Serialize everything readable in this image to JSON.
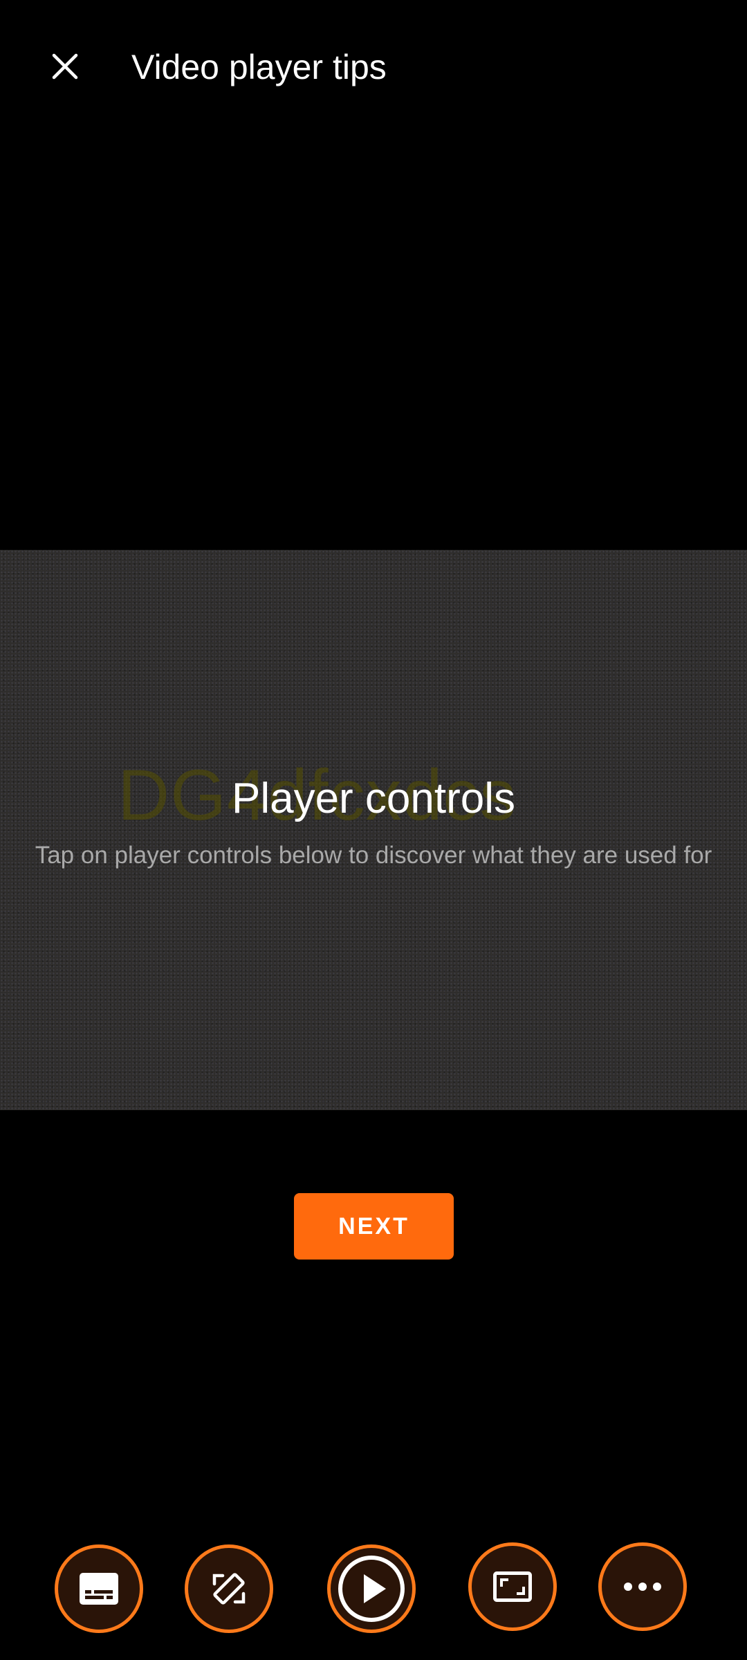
{
  "header": {
    "title": "Video player tips",
    "close_icon": "close-icon"
  },
  "preview": {
    "watermark": "DG4dfcxdcs",
    "title": "Player controls",
    "subtitle": "Tap on player controls below to discover what they are used for"
  },
  "next_button": {
    "label": "NEXT"
  },
  "controls": [
    {
      "name": "subtitles",
      "icon": "subtitles-icon"
    },
    {
      "name": "rotate",
      "icon": "screen-rotation-icon"
    },
    {
      "name": "play",
      "icon": "play-icon"
    },
    {
      "name": "aspect-ratio",
      "icon": "aspect-ratio-icon"
    },
    {
      "name": "more",
      "icon": "more-horizontal-icon"
    }
  ],
  "colors": {
    "accent": "#ff6a0d",
    "control_border": "#ff7a1a",
    "control_fill": "#2a1408",
    "background": "#000000",
    "preview_bg": "#2b2b2b",
    "subtitle_text": "#a9a9a9"
  }
}
